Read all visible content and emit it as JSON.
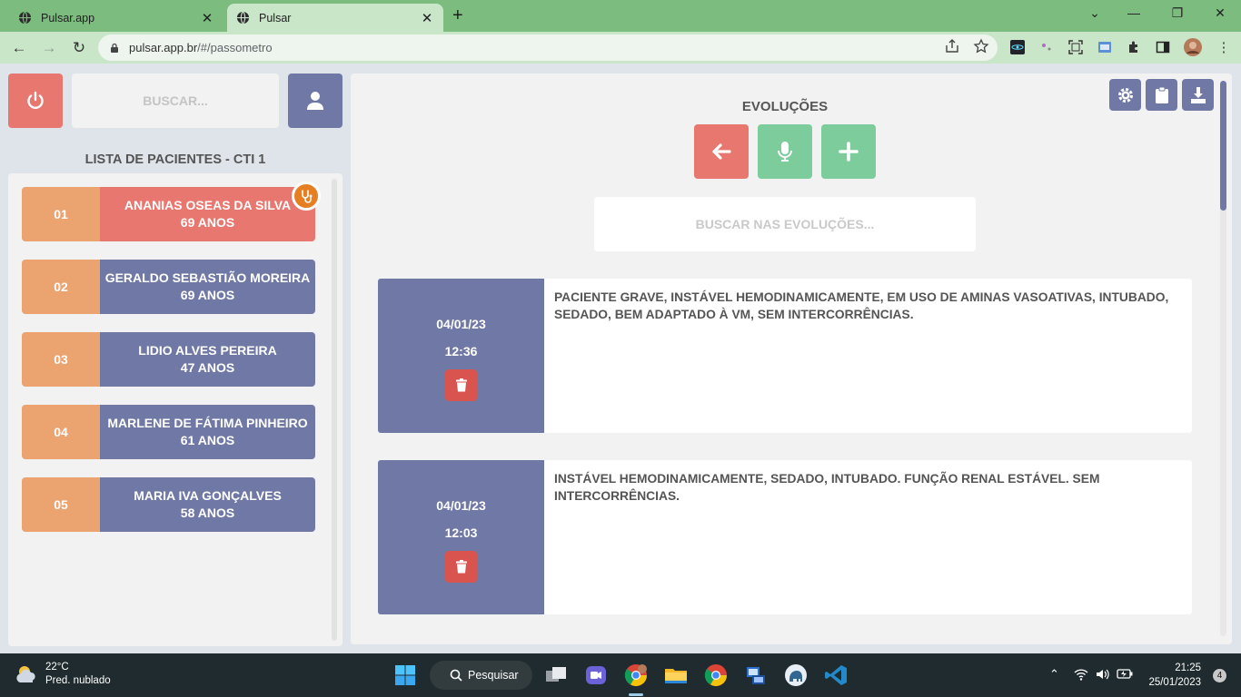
{
  "browser": {
    "tabs": [
      {
        "title": "Pulsar.app",
        "active": false
      },
      {
        "title": "Pulsar",
        "active": true
      }
    ],
    "url_host": "pulsar.app.br",
    "url_path": "/#/passometro"
  },
  "header": {
    "search_placeholder": "BUSCAR..."
  },
  "patient_list": {
    "title": "LISTA DE PACIENTES - CTI 1",
    "patients": [
      {
        "number": "01",
        "name": "ANANIAS OSEAS DA SILVA",
        "age": "69 ANOS",
        "alert": true
      },
      {
        "number": "02",
        "name": "GERALDO SEBASTIÃO MOREIRA",
        "age": "69 ANOS",
        "alert": false
      },
      {
        "number": "03",
        "name": "LIDIO ALVES PEREIRA",
        "age": "47 ANOS",
        "alert": false
      },
      {
        "number": "04",
        "name": "MARLENE DE FÁTIMA PINHEIRO",
        "age": "61 ANOS",
        "alert": false
      },
      {
        "number": "05",
        "name": "MARIA IVA GONÇALVES",
        "age": "58 ANOS",
        "alert": false
      }
    ]
  },
  "evolutions": {
    "title": "EVOLUÇÕES",
    "search_placeholder": "BUSCAR NAS EVOLUÇÕES...",
    "items": [
      {
        "date": "04/01/23",
        "time": "12:36",
        "text": "PACIENTE GRAVE, INSTÁVEL HEMODINAMICAMENTE, EM USO DE AMINAS VASOATIVAS, INTUBADO, SEDADO, BEM ADAPTADO À VM, SEM INTERCORRÊNCIAS."
      },
      {
        "date": "04/01/23",
        "time": "12:03",
        "text": "INSTÁVEL HEMODINAMICAMENTE, SEDADO, INTUBADO. FUNÇÃO RENAL ESTÁVEL. SEM INTERCORRÊNCIAS."
      }
    ]
  },
  "taskbar": {
    "weather_temp": "22°C",
    "weather_desc": "Pred. nublado",
    "search_label": "Pesquisar",
    "time": "21:25",
    "date": "25/01/2023",
    "notification_count": "4"
  },
  "colors": {
    "accent_purple": "#7079a6",
    "danger_red": "#e8776f",
    "success_green": "#7dcc9b",
    "number_orange": "#eba36f",
    "browser_green": "#7cbd7f"
  }
}
